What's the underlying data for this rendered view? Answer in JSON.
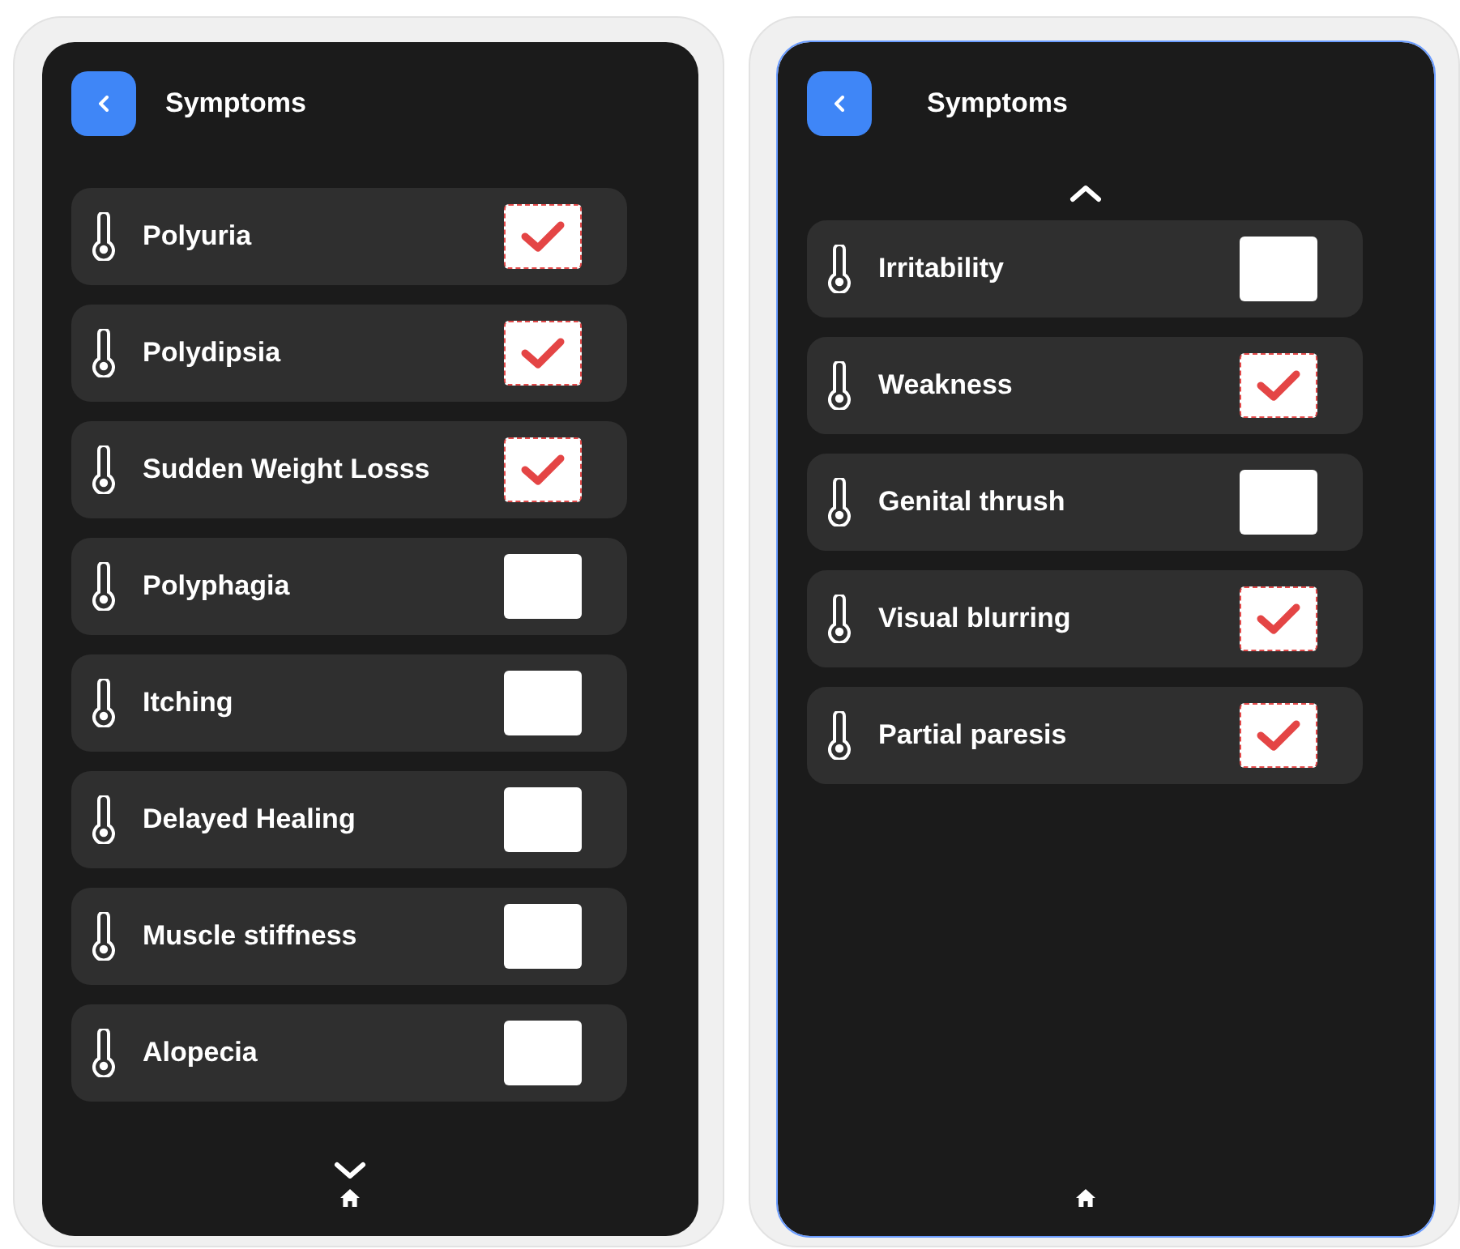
{
  "screens": [
    {
      "title": "Symptoms",
      "scroll_arrow": {
        "kind": "down"
      },
      "items": [
        {
          "label": "Polyuria",
          "checked": true
        },
        {
          "label": "Polydipsia",
          "checked": true
        },
        {
          "label": "Sudden Weight Losss",
          "checked": true
        },
        {
          "label": "Polyphagia",
          "checked": false
        },
        {
          "label": "Itching",
          "checked": false
        },
        {
          "label": "Delayed Healing",
          "checked": false
        },
        {
          "label": "Muscle stiffness",
          "checked": false
        },
        {
          "label": "Alopecia",
          "checked": false
        }
      ]
    },
    {
      "title": "Symptoms",
      "scroll_arrow": {
        "kind": "up"
      },
      "items": [
        {
          "label": "Irritability",
          "checked": false
        },
        {
          "label": "Weakness",
          "checked": true
        },
        {
          "label": "Genital thrush",
          "checked": false
        },
        {
          "label": "Visual blurring",
          "checked": true
        },
        {
          "label": "Partial paresis",
          "checked": true
        }
      ]
    }
  ]
}
